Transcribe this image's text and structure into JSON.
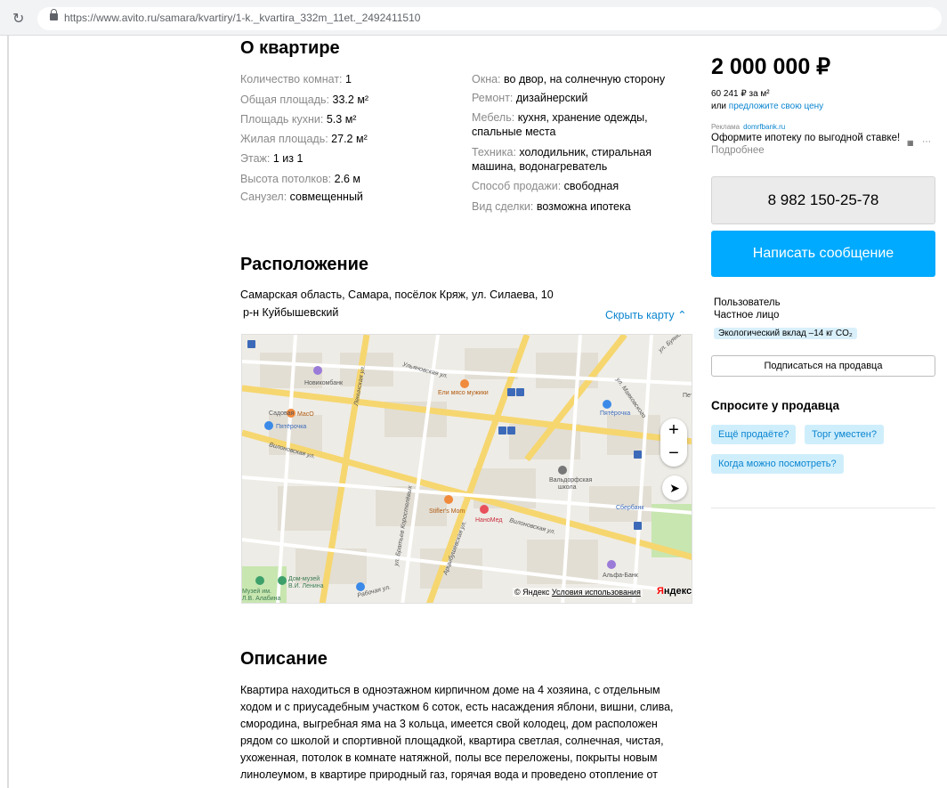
{
  "browser": {
    "url": "https://www.avito.ru/samara/kvartiry/1-k._kvartira_332m_11et._2492411510"
  },
  "about": {
    "title": "О квартире",
    "left": [
      {
        "k": "Количество комнат:",
        "v": "1"
      },
      {
        "k": "Общая площадь:",
        "v": "33.2 м²"
      },
      {
        "k": "Площадь кухни:",
        "v": "5.3 м²"
      },
      {
        "k": "Жилая площадь:",
        "v": "27.2 м²"
      },
      {
        "k": "Этаж:",
        "v": "1 из 1"
      },
      {
        "k": "Высота потолков:",
        "v": "2.6 м"
      },
      {
        "k": "Санузел:",
        "v": "совмещенный"
      }
    ],
    "right": [
      {
        "k": "Окна:",
        "v": "во двор, на солнечную сторону"
      },
      {
        "k": "Ремонт:",
        "v": "дизайнерский"
      },
      {
        "k": "Мебель:",
        "v": "кухня, хранение одежды,",
        "v2": "спальные места"
      },
      {
        "k": "Техника:",
        "v": "холодильник, стиральная",
        "v2": "машина, водонагреватель"
      },
      {
        "k": "Способ продажи:",
        "v": "свободная"
      },
      {
        "k": "Вид сделки:",
        "v": "возможна ипотека"
      }
    ]
  },
  "location": {
    "title": "Расположение",
    "address": "Самарская область, Самара, посёлок Кряж, ул. Силаева, 10",
    "district": "р-н Куйбышевский",
    "hide_map": "Скрыть карту ⌃",
    "map_copyright": "© Яндекс",
    "map_terms": "Условия использования",
    "map_logo_red": "Я",
    "map_logo_black": "ндекс"
  },
  "sidebar": {
    "price": "2 000 000 ₽",
    "price_per_m": "60 241 ₽ за м²",
    "offer_prefix": "или",
    "offer_link": "предложите свою цену",
    "ad_label": "Реклама",
    "ad_domain": "domrfbank.ru",
    "ad_text": "Оформите ипотеку по выгодной ставке!",
    "ad_more": "Подробнее",
    "phone": "8 982 150-25-78",
    "message_button": "Написать сообщение",
    "seller_name": "Пользователь",
    "seller_type": "Частное лицо",
    "eco_badge": "Экологический вклад –14 кг CO₂",
    "subscribe": "Подписаться на продавца",
    "ask_title": "Спросите у продавца",
    "ask_chips": [
      "Ещё продаёте?",
      "Торг уместен?",
      "Когда можно посмотреть?"
    ]
  },
  "description": {
    "title": "Описание",
    "text": "Квартира находиться в одноэтажном кирпичном доме на 4 хозяина, с отдельным ходом и с приусадебным участком 6 соток, есть насаждения яблони, вишни, слива, смородина, выгребная яма на 3 кольца, имеется свой колодец, дом расположен рядом со школой и спортивной площадкой, квартира светлая, солнечная, чистая, ухоженная, потолок в комнате натяжной, полы все переложены, покрыты новым линолеумом, в квартире природный газ, горячая вода и проведено отопление от"
  },
  "map_labels": [
    "Ульяновская ул.",
    "Ленинская ул.",
    "Вилоновская ул.",
    "ул. Маяковского",
    "ул. Буянова",
    "Рабочая ул.",
    "ул. Братьев Коростелёвых",
    "Арцыбушевская ул.",
    "Новикомбанк",
    "Пятёрочка",
    "MacO",
    "Ели мясо мужики",
    "Садовая",
    "Вальдорфская школа",
    "Stifler's Mom",
    "НаноМед",
    "Сбербанк",
    "Альфа-Банк",
    "Дом-музей В.И. Ленина",
    "Музей им. Л.В. Алабина",
    "Петербург"
  ]
}
